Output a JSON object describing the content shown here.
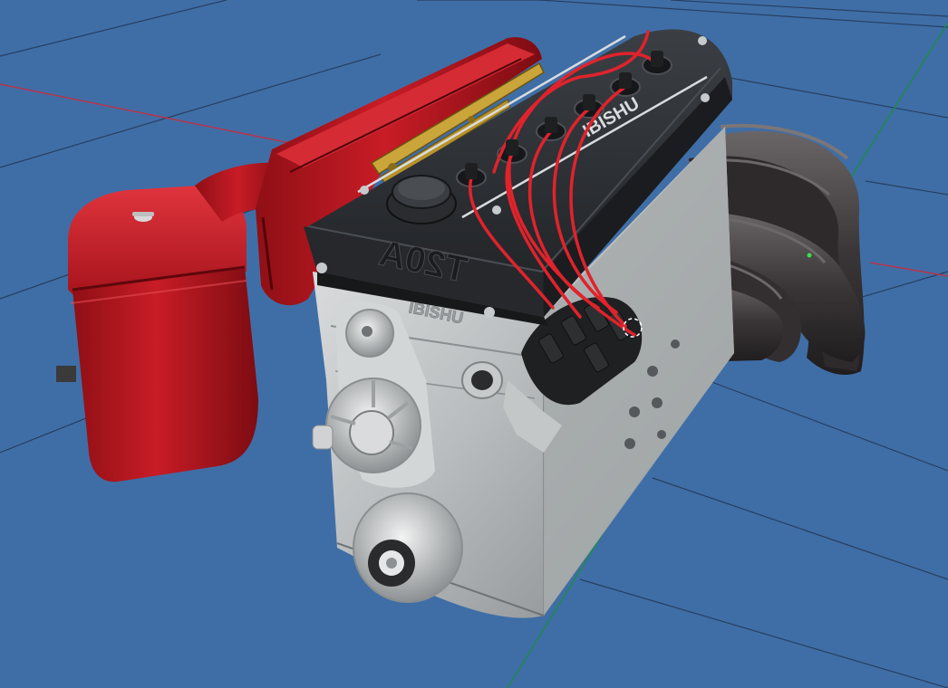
{
  "viewport": {
    "background_color": "#3f6ea6",
    "grid_line_color": "#1f2f4a",
    "x_axis_color": "#b8344a",
    "z_axis_color": "#1f8a4a"
  },
  "model": {
    "head_text": "T20A",
    "cam_cover_text": "IBISHU",
    "block_text": "IBISHU",
    "colors": {
      "intake_red": "#b3161f",
      "valve_cover": "#2b2e32",
      "block_silver": "#b9bcbe",
      "header_pipes": "#3a3637",
      "spark_wires": "#e0232c",
      "bracket_brass": "#c9a53a"
    }
  },
  "gizmo": {
    "cursor_ring_color": "#ffffff",
    "pivot_marker_color": "#39e04a"
  }
}
